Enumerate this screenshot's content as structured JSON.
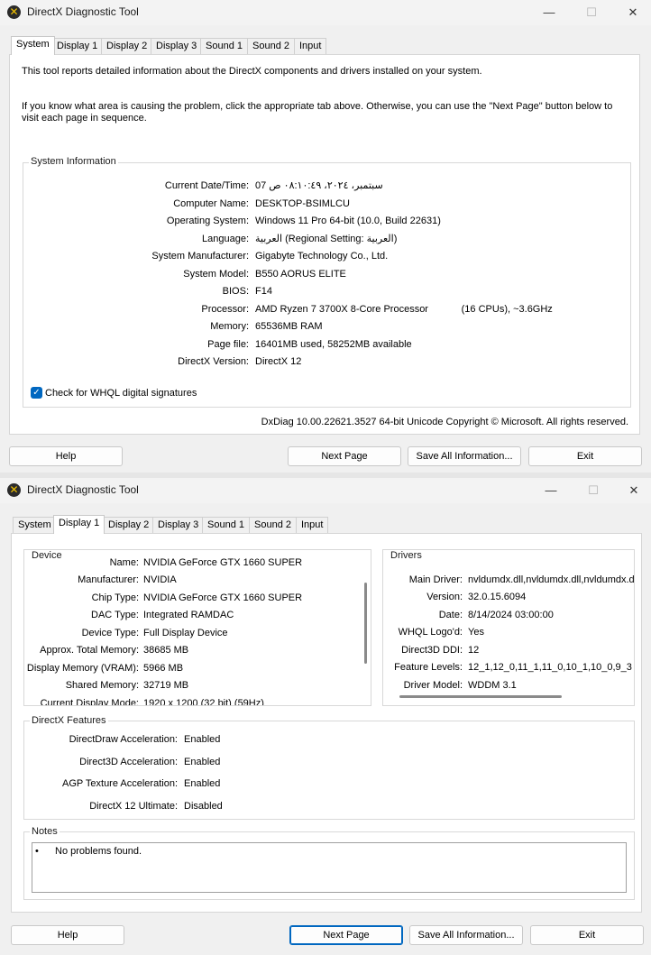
{
  "window1": {
    "title": "DirectX Diagnostic Tool",
    "tabs": [
      "System",
      "Display 1",
      "Display 2",
      "Display 3",
      "Sound 1",
      "Sound 2",
      "Input"
    ],
    "active_tab": "System",
    "intro1": "This tool reports detailed information about the DirectX components and drivers installed on your system.",
    "intro2": "If you know what area is causing the problem, click the appropriate tab above.  Otherwise, you can use the \"Next Page\" button below to visit each page in sequence.",
    "system_info": {
      "title": "System Information",
      "rows": [
        {
          "label": "Current Date/Time:",
          "value": "سبتمبر، ٢٠٢٤، ٠٨:١٠:٤٩ ص 07"
        },
        {
          "label": "Computer Name:",
          "value": "DESKTOP-BSIMLCU"
        },
        {
          "label": "Operating System:",
          "value": "Windows 11 Pro 64-bit (10.0, Build 22631)"
        },
        {
          "label": "Language:",
          "value": "العربية (Regional Setting: العربية)"
        },
        {
          "label": "System Manufacturer:",
          "value": "Gigabyte Technology Co., Ltd."
        },
        {
          "label": "System Model:",
          "value": "B550 AORUS ELITE"
        },
        {
          "label": "BIOS:",
          "value": "F14"
        },
        {
          "label": "Processor:",
          "value": "AMD Ryzen 7 3700X 8-Core Processor            (16 CPUs), ~3.6GHz"
        },
        {
          "label": "Memory:",
          "value": "65536MB RAM"
        },
        {
          "label": "Page file:",
          "value": "16401MB used, 58252MB available"
        },
        {
          "label": "DirectX Version:",
          "value": "DirectX 12"
        }
      ]
    },
    "whql_label": "Check for WHQL digital signatures",
    "footer": "DxDiag 10.00.22621.3527 64-bit Unicode  Copyright © Microsoft. All rights reserved.",
    "buttons": {
      "help": "Help",
      "next": "Next Page",
      "save": "Save All Information...",
      "exit": "Exit"
    }
  },
  "window2": {
    "title": "DirectX Diagnostic Tool",
    "tabs": [
      "System",
      "Display 1",
      "Display 2",
      "Display 3",
      "Sound 1",
      "Sound 2",
      "Input"
    ],
    "active_tab": "Display 1",
    "device": {
      "title": "Device",
      "rows": [
        {
          "label": "Name:",
          "value": "NVIDIA GeForce GTX 1660 SUPER"
        },
        {
          "label": "Manufacturer:",
          "value": "NVIDIA"
        },
        {
          "label": "Chip Type:",
          "value": "NVIDIA GeForce GTX 1660 SUPER"
        },
        {
          "label": "DAC Type:",
          "value": "Integrated RAMDAC"
        },
        {
          "label": "Device Type:",
          "value": "Full Display Device"
        },
        {
          "label": "Approx. Total Memory:",
          "value": "38685 MB"
        },
        {
          "label": "Display Memory (VRAM):",
          "value": "5966 MB"
        },
        {
          "label": "Shared Memory:",
          "value": "32719 MB"
        },
        {
          "label": "Current Display Mode:",
          "value": "1920 x 1200 (32 bit) (59Hz)"
        }
      ]
    },
    "drivers": {
      "title": "Drivers",
      "rows": [
        {
          "label": "Main Driver:",
          "value": "nvldumdx.dll,nvldumdx.dll,nvldumdx.d"
        },
        {
          "label": "Version:",
          "value": "32.0.15.6094"
        },
        {
          "label": "Date:",
          "value": "8/14/2024 03:00:00"
        },
        {
          "label": "WHQL Logo'd:",
          "value": "Yes"
        },
        {
          "label": "Direct3D DDI:",
          "value": "12"
        },
        {
          "label": "Feature Levels:",
          "value": "12_1,12_0,11_1,11_0,10_1,10_0,9_3"
        },
        {
          "label": "Driver Model:",
          "value": "WDDM 3.1"
        }
      ]
    },
    "features": {
      "title": "DirectX Features",
      "rows": [
        {
          "label": "DirectDraw Acceleration:",
          "value": "Enabled"
        },
        {
          "label": "Direct3D Acceleration:",
          "value": "Enabled"
        },
        {
          "label": "AGP Texture Acceleration:",
          "value": "Enabled"
        },
        {
          "label": "DirectX 12 Ultimate:",
          "value": "Disabled"
        }
      ]
    },
    "notes": {
      "title": "Notes",
      "bullet": "•",
      "text": "No problems found."
    },
    "buttons": {
      "help": "Help",
      "next": "Next Page",
      "save": "Save All Information...",
      "exit": "Exit"
    }
  }
}
